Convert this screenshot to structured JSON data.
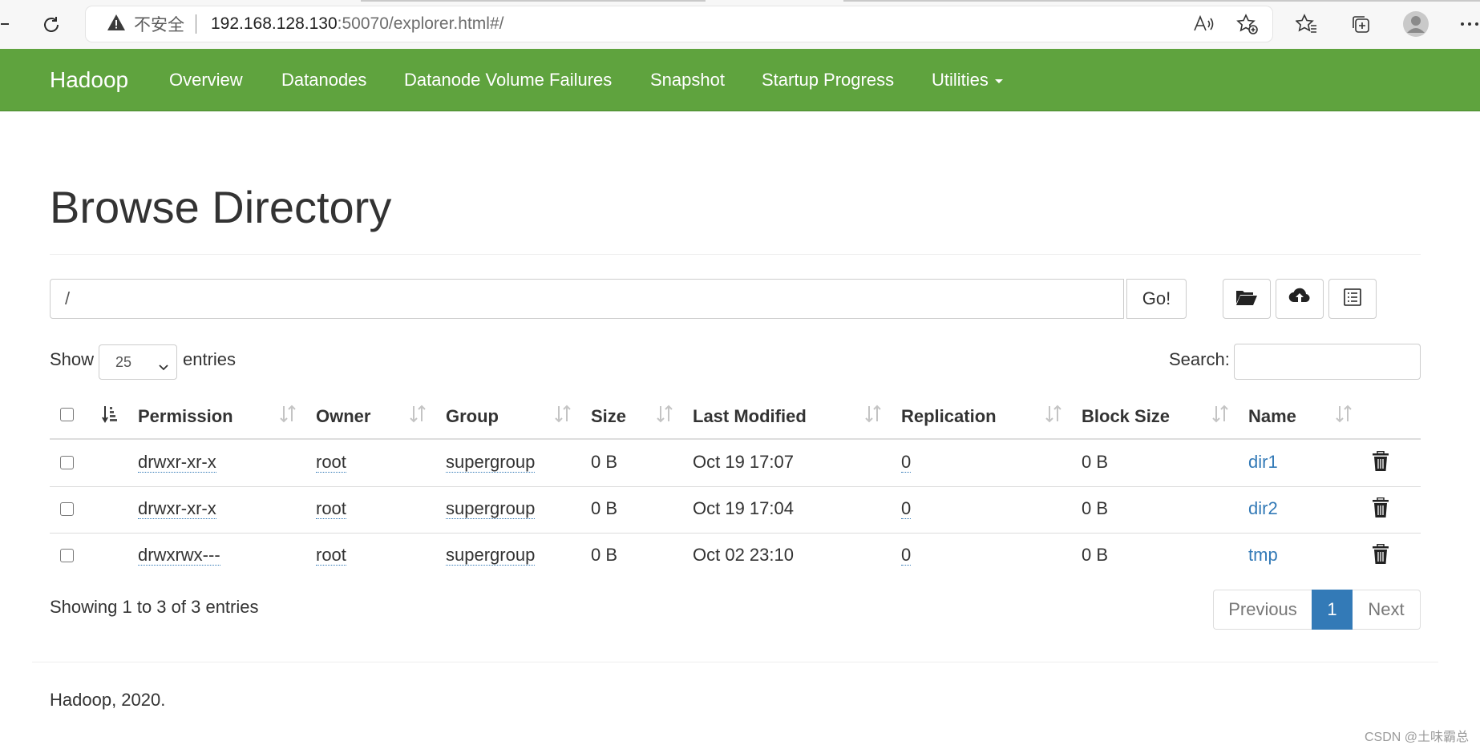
{
  "browser": {
    "security_label": "不安全",
    "url_host": "192.168.128.130",
    "url_rest": ":50070/explorer.html#/"
  },
  "navbar": {
    "brand": "Hadoop",
    "items": [
      "Overview",
      "Datanodes",
      "Datanode Volume Failures",
      "Snapshot",
      "Startup Progress",
      "Utilities"
    ],
    "color": "#5fa33e"
  },
  "page": {
    "title": "Browse Directory",
    "path_value": "/",
    "go_label": "Go!",
    "show_label": "Show",
    "entries_value": "25",
    "entries_label": "entries",
    "search_label": "Search:"
  },
  "table": {
    "headers": [
      "Permission",
      "Owner",
      "Group",
      "Size",
      "Last Modified",
      "Replication",
      "Block Size",
      "Name"
    ],
    "rows": [
      {
        "permission": "drwxr-xr-x",
        "owner": "root",
        "group": "supergroup",
        "size": "0 B",
        "last_modified": "Oct 19 17:07",
        "replication": "0",
        "block_size": "0 B",
        "name": "dir1"
      },
      {
        "permission": "drwxr-xr-x",
        "owner": "root",
        "group": "supergroup",
        "size": "0 B",
        "last_modified": "Oct 19 17:04",
        "replication": "0",
        "block_size": "0 B",
        "name": "dir2"
      },
      {
        "permission": "drwxrwx---",
        "owner": "root",
        "group": "supergroup",
        "size": "0 B",
        "last_modified": "Oct 02 23:10",
        "replication": "0",
        "block_size": "0 B",
        "name": "tmp"
      }
    ]
  },
  "pagination": {
    "info": "Showing 1 to 3 of 3 entries",
    "previous": "Previous",
    "current": "1",
    "next": "Next",
    "active_color": "#337ab7"
  },
  "footer": {
    "text": "Hadoop, 2020.",
    "watermark": "CSDN @土味霸总"
  }
}
